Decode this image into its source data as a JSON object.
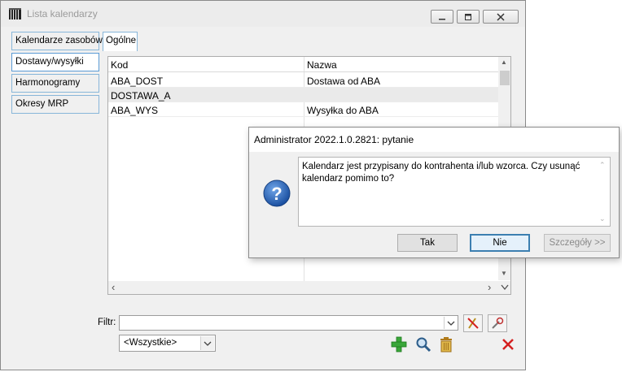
{
  "window": {
    "title": "Lista kalendarzy"
  },
  "sidebar": {
    "items": [
      {
        "label": "Kalendarze zasobów"
      },
      {
        "label": "Dostawy/wysyłki"
      },
      {
        "label": "Harmonogramy"
      },
      {
        "label": "Okresy MRP"
      }
    ],
    "active_index": 1
  },
  "tabs": [
    {
      "label": "Ogólne"
    }
  ],
  "grid": {
    "columns": [
      "Kod",
      "Nazwa"
    ],
    "rows": [
      [
        "ABA_DOST",
        "Dostawa od ABA"
      ],
      [
        "DOSTAWA_A",
        ""
      ],
      [
        "ABA_WYS",
        "Wysyłka do ABA"
      ]
    ]
  },
  "filter": {
    "label": "Filtr:",
    "value": "",
    "select_value": "<Wszystkie>"
  },
  "dialog": {
    "title": "Administrator 2022.1.0.2821: pytanie",
    "message": "Kalendarz jest przypisany do kontrahenta i/lub wzorca. Czy usunąć kalendarz pomimo to?",
    "buttons": {
      "yes": "Tak",
      "no": "Nie",
      "details": "Szczegóły >>"
    }
  },
  "colors": {
    "accent_border": "#88b6d9",
    "default_button_border": "#3c7fb1",
    "add_green": "#3aa63a",
    "delete_red": "#d42020"
  }
}
